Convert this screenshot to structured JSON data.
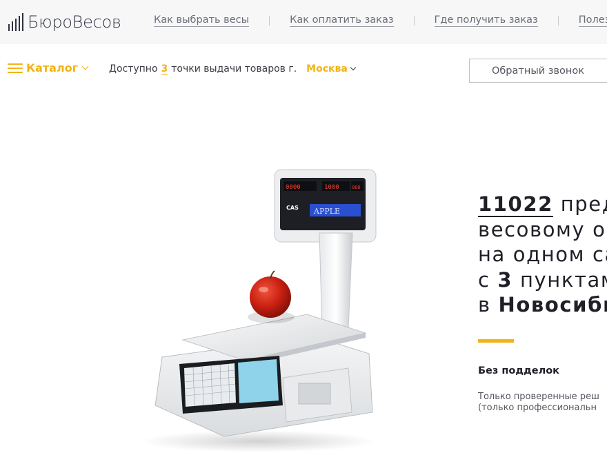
{
  "brand": {
    "name": "БюроВесов"
  },
  "topnav": {
    "items": [
      {
        "label": "Как выбрать весы"
      },
      {
        "label": "Как оплатить заказ"
      },
      {
        "label": "Где получить заказ"
      },
      {
        "label": "Полезн"
      }
    ]
  },
  "subbar": {
    "catalog_label": "Каталог",
    "pickup_prefix": "Доступно",
    "pickup_count": "3",
    "pickup_suffix": "точки выдачи товаров г.",
    "city": "Москва",
    "callback_label": "Обратный звонок"
  },
  "hero": {
    "line1_count": "11022",
    "line1_rest": " предл",
    "line2": "весовому об",
    "line3": "на одном са",
    "line4_prefix": "с ",
    "line4_num": "3",
    "line4_rest": " пунктам",
    "line5_prefix": "в ",
    "line5_city": "Новосиби",
    "feature_title": "Без подделок",
    "feature_text_1": "Только проверенные реш",
    "feature_text_2": "(только профессиональн"
  },
  "product_image": {
    "display_brand": "CAS",
    "display_text": "APPLE",
    "display_digits": [
      "0000",
      "1000",
      "000"
    ]
  },
  "colors": {
    "accent": "#f2b315",
    "text_dark": "#1f2027",
    "topbar_bg": "#f7f7f8"
  }
}
